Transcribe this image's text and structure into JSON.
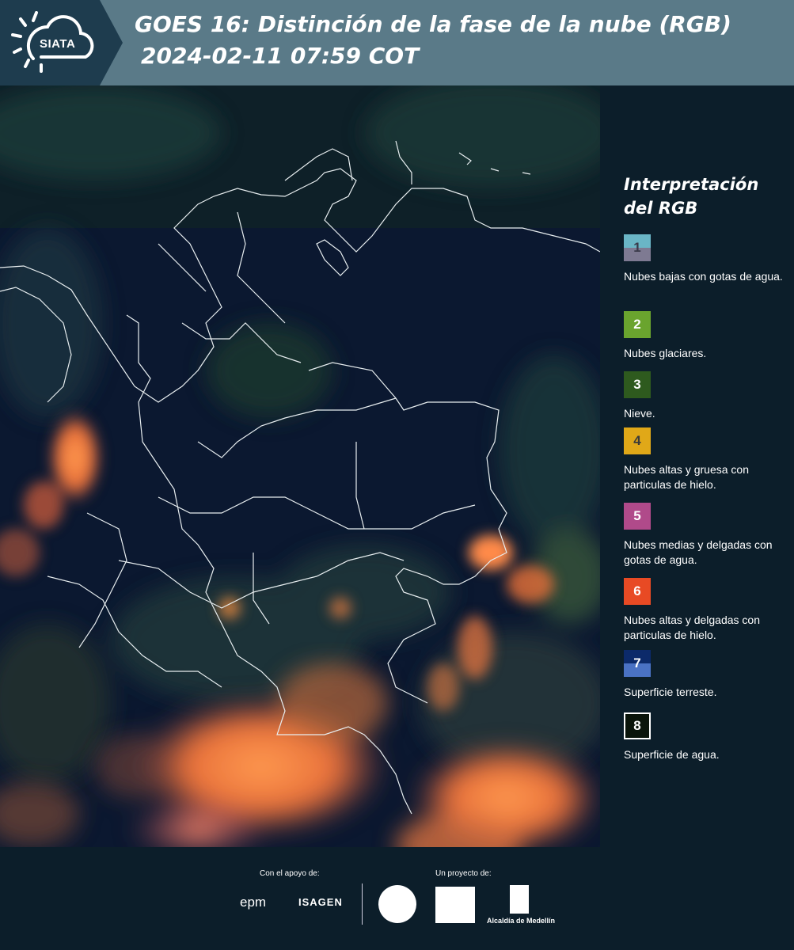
{
  "header": {
    "logo_text": "SIATA",
    "title_line1": "GOES 16: Distinción de la fase de la nube (RGB)",
    "title_line2": "2024-02-11 07:59 COT"
  },
  "legend": {
    "title": "Interpretación del RGB",
    "items": [
      {
        "number": "1",
        "description": "Nubes bajas con gotas de agua.",
        "color_top": "#6ab6c6",
        "color_bottom": "#7e7a92",
        "text_color": "#3a3a4a"
      },
      {
        "number": "2",
        "description": "Nubes glaciares.",
        "color_top": "#6aa42e",
        "color_bottom": "#6aa42e",
        "text_color": "#ffffff"
      },
      {
        "number": "3",
        "description": "Nieve.",
        "color_top": "#2e5a1e",
        "color_bottom": "#2e5a1e",
        "text_color": "#ffffff"
      },
      {
        "number": "4",
        "description": "Nubes altas y gruesa con particulas de hielo.",
        "color_top": "#e0a818",
        "color_bottom": "#e0a818",
        "text_color": "#3a3a3a"
      },
      {
        "number": "5",
        "description": "Nubes medias y delgadas con gotas de agua.",
        "color_top": "#b04a8a",
        "color_bottom": "#b04a8a",
        "text_color": "#ffffff"
      },
      {
        "number": "6",
        "description": "Nubes altas y delgadas con particulas de hielo.",
        "color_top": "#e84a24",
        "color_bottom": "#e84a24",
        "text_color": "#ffffff"
      },
      {
        "number": "7",
        "description": "Superficie terreste.",
        "color_top": "#0c2a6a",
        "color_bottom": "#4a72c4",
        "text_color": "#ffffff"
      },
      {
        "number": "8",
        "description": "Superficie de agua.",
        "color_top": "#0a140a",
        "color_bottom": "#0a140a",
        "text_color": "#ffffff"
      }
    ]
  },
  "footer": {
    "support_label": "Con el apoyo de:",
    "project_label": "Un proyecto de:",
    "sponsor1": "epm",
    "sponsor2": "ISAGEN",
    "partner_alcaldia": "Alcaldía de Medellín"
  }
}
